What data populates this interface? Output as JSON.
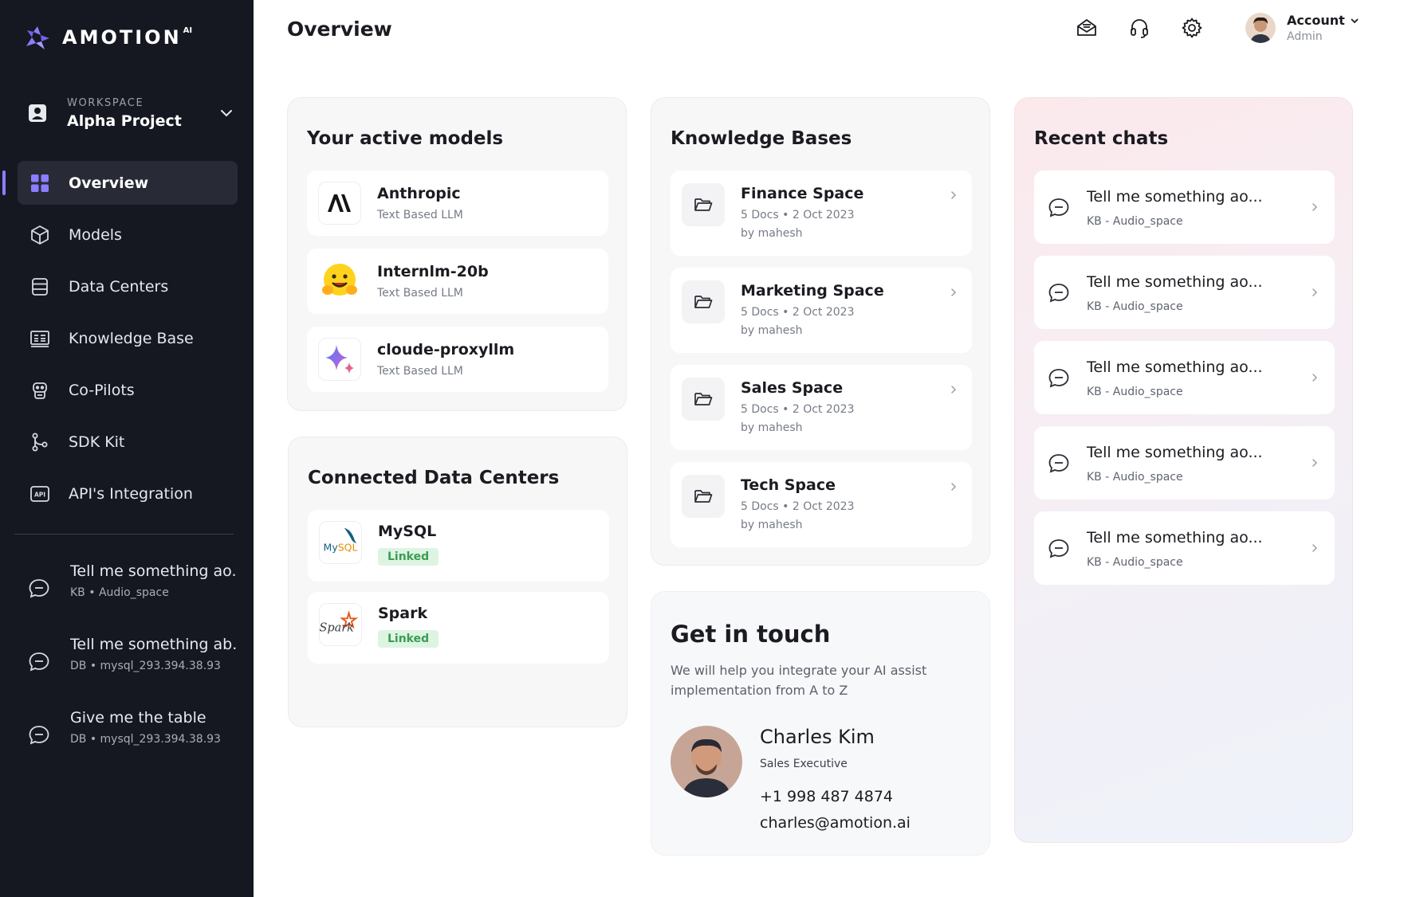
{
  "sidebar": {
    "brand": "AMOTION",
    "brand_sup": "AI",
    "workspace_label": "WORKSPACE",
    "workspace_name": "Alpha Project",
    "nav": [
      {
        "label": "Overview",
        "icon": "grid-icon"
      },
      {
        "label": "Models",
        "icon": "cube-icon"
      },
      {
        "label": "Data Centers",
        "icon": "database-icon"
      },
      {
        "label": "Knowledge Base",
        "icon": "book-icon"
      },
      {
        "label": "Co-Pilots",
        "icon": "robot-icon"
      },
      {
        "label": "SDK Kit",
        "icon": "git-branch-icon"
      },
      {
        "label": "API's Integration",
        "icon": "api-icon"
      }
    ],
    "recent_chats": [
      {
        "title": "Tell me something ao...",
        "sub": "KB • Audio_space"
      },
      {
        "title": "Tell me something ab...",
        "sub": "DB • mysql_293.394.38.93"
      },
      {
        "title": "Give me the table",
        "sub": "DB • mysql_293.394.38.93"
      }
    ]
  },
  "header": {
    "title": "Overview",
    "account_name": "Account",
    "account_role": "Admin"
  },
  "models": {
    "title": "Your active models",
    "items": [
      {
        "name": "Anthropic",
        "type": "Text Based LLM"
      },
      {
        "name": "Internlm-20b",
        "type": "Text Based LLM"
      },
      {
        "name": "cloude-proxyllm",
        "type": "Text Based LLM"
      }
    ]
  },
  "data_centers": {
    "title": "Connected Data Centers",
    "items": [
      {
        "name": "MySQL",
        "status": "Linked",
        "logo_text": "MySQL"
      },
      {
        "name": "Spark",
        "status": "Linked",
        "logo_text": "Spark"
      }
    ]
  },
  "knowledge_bases": {
    "title": "Knowledge Bases",
    "items": [
      {
        "name": "Finance Space",
        "meta": "5 Docs  •  2 Oct 2023",
        "by": "by mahesh"
      },
      {
        "name": "Marketing Space",
        "meta": "5 Docs  •  2 Oct 2023",
        "by": "by mahesh"
      },
      {
        "name": "Sales Space",
        "meta": "5 Docs  •  2 Oct 2023",
        "by": "by mahesh"
      },
      {
        "name": "Tech Space",
        "meta": "5 Docs  •  2 Oct 2023",
        "by": "by mahesh"
      }
    ]
  },
  "get_in_touch": {
    "title": "Get in touch",
    "description": "We will help you integrate your AI assist implementation from A to Z",
    "name": "Charles Kim",
    "role": "Sales Executive",
    "phone": "+1 998 487 4874",
    "email": "charles@amotion.ai"
  },
  "recent_chats": {
    "title": "Recent chats",
    "items": [
      {
        "title": "Tell me something ao...",
        "sub": "KB - Audio_space"
      },
      {
        "title": "Tell me something ao...",
        "sub": "KB - Audio_space"
      },
      {
        "title": "Tell me something ao...",
        "sub": "KB - Audio_space"
      },
      {
        "title": "Tell me something ao...",
        "sub": "KB - Audio_space"
      },
      {
        "title": "Tell me something ao...",
        "sub": "KB - Audio_space"
      }
    ]
  },
  "colors": {
    "sidebar_bg": "#151821",
    "accent": "#8b7dff",
    "linked_badge": "#3a9d52"
  }
}
